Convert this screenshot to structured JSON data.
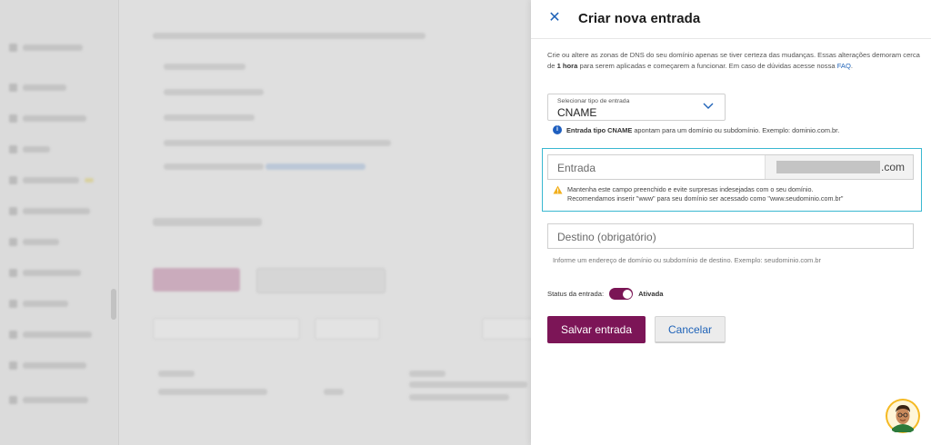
{
  "panel": {
    "title": "Criar nova entrada",
    "close_icon": "close-icon",
    "intro": {
      "part1": "Crie ou altere as zonas de DNS do seu domínio apenas se tiver certeza das mudanças. Essas alterações demoram cerca de ",
      "bold": "1 hora",
      "part2": " para serem aplicadas e começarem a funcionar. Em caso de dúvidas acesse nossa ",
      "link": "FAQ",
      "end": "."
    },
    "entry_type": {
      "label": "Selecionar tipo de entrada",
      "value": "CNAME"
    },
    "info": {
      "bold": "Entrada tipo CNAME",
      "text": " apontam para um domínio ou subdomínio. Exemplo: dominio.com.br."
    },
    "entry_field": {
      "placeholder": "Entrada",
      "suffix": ".com"
    },
    "warning": {
      "line1": "Mantenha este campo preenchido e evite surpresas indesejadas com o seu domínio.",
      "line2": "Recomendamos inserir \"www\" para seu domínio ser acessado como \"www.seudominio.com.br\""
    },
    "destination_field": {
      "placeholder": "Destino (obrigatório)",
      "help": "Informe um endereço de domínio ou subdomínio de destino. Exemplo: seudominio.com.br"
    },
    "status": {
      "label": "Status da entrada:",
      "value": "Ativada",
      "enabled": true
    },
    "buttons": {
      "save": "Salvar entrada",
      "cancel": "Cancelar"
    }
  },
  "colors": {
    "primary": "#7c1557",
    "link": "#1f63b8",
    "highlight_border": "#3ab8d1",
    "warning": "#f2b01e"
  }
}
